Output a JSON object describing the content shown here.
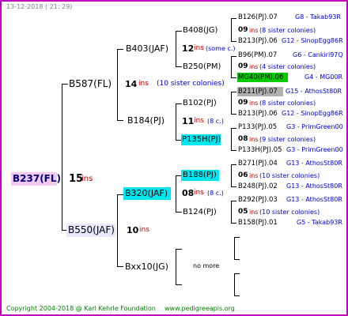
{
  "header": {
    "date": "13-12-2018 ( 21: 29)"
  },
  "footer": {
    "copyright": "Copyright 2004-2018 @ Karl Kehrle Foundation",
    "website": "www.pedigreeapis.org"
  },
  "colors": {
    "frame": "#c000c0",
    "highlight_cyan": "#00e5ee",
    "highlight_green": "#00cc00",
    "highlight_gray": "#b0b0b0",
    "highlight_pink": "#f0c8f0"
  },
  "tree": {
    "root": {
      "name": "B237(FL)",
      "ins_num": "15",
      "ins_label": "ins"
    },
    "g1": [
      {
        "name": "B587(FL)",
        "ins_num": "14",
        "ins_label": "ins",
        "ins_note": "(10 sister colonies)"
      },
      {
        "name": "B550(JAF)",
        "ins_num": "10",
        "ins_label": "ins"
      }
    ],
    "g2": [
      {
        "name": "B403(JAF)",
        "ins_num": "12",
        "ins_label": "ins",
        "ins_note": "(some c.)"
      },
      {
        "name": "B184(PJ)",
        "ins_num": "11",
        "ins_label": "ins",
        "ins_note": "(8 c.)"
      },
      {
        "name": "B320(JAF)",
        "ins_num": "08",
        "ins_label": "ins",
        "ins_note": "(8 c.)"
      },
      {
        "name": "Bxx10(JG)",
        "more": "no more"
      }
    ],
    "g3": [
      {
        "name": "B408(JG)",
        "ins_num": "09",
        "ins_label": "ins",
        "ins_note": "(8 sister colonies)"
      },
      {
        "name": "B250(PM)",
        "ins_num": "09",
        "ins_label": "ins",
        "ins_note": "(4 sister colonies)"
      },
      {
        "name": "B102(PJ)",
        "ins_num": "09",
        "ins_label": "ins",
        "ins_note": "(8 sister colonies)"
      },
      {
        "name": "P135H(PJ)",
        "ins_num": "08",
        "ins_label": "ins",
        "ins_note": "(9 sister colonies)"
      },
      {
        "name": "B188(PJ)",
        "ins_num": "06",
        "ins_label": "ins",
        "ins_note": "(10 sister colonies)"
      },
      {
        "name": "B124(PJ)",
        "ins_num": "05",
        "ins_label": "ins",
        "ins_note": "(10 sister colonies)"
      }
    ],
    "g4": [
      {
        "name": "B126(PJ).07",
        "info": "G8 - Takab93R"
      },
      {
        "name": "B213(PJ).06",
        "info": "G12 - SinopEgg86R"
      },
      {
        "name": "B96(PM).07",
        "info": "G6 - Cankiri97Q"
      },
      {
        "name": "MG40(PM).06",
        "info": "G4 - MG00R"
      },
      {
        "name": "B211(PJ).07",
        "info": "G15 - AthosSt80R"
      },
      {
        "name": "B213(PJ).06",
        "info": "G12 - SinopEgg86R"
      },
      {
        "name": "P133(PJ).05",
        "info": "G3 - PrimGreen00"
      },
      {
        "name": "P133H(PJ).05",
        "info": "G3 - PrimGreen00"
      },
      {
        "name": "B271(PJ).04",
        "info": "G13 - AthosSt80R"
      },
      {
        "name": "B248(PJ).02",
        "info": "G13 - AthosSt80R"
      },
      {
        "name": "B292(PJ).03",
        "info": "G13 - AthosSt80R"
      },
      {
        "name": "B158(PJ).01",
        "info": "G5 - Takab93R"
      }
    ]
  }
}
